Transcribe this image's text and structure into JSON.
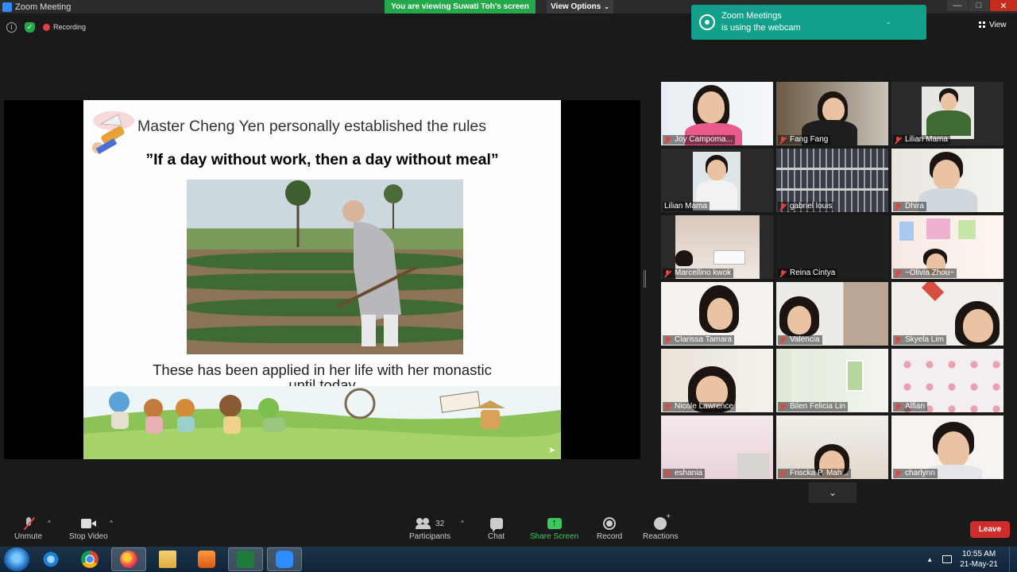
{
  "window": {
    "title": "Zoom Meeting",
    "viewing_banner": "You are viewing Suwati Toh's screen",
    "view_options": "View Options",
    "min": "—",
    "max": "□",
    "close": "✕"
  },
  "meeting_info": {
    "recording_label": "Recording"
  },
  "toast": {
    "line1": "Zoom Meetings",
    "line2": "is using the webcam"
  },
  "view_button": "View",
  "slide": {
    "title": "Master Cheng Yen personally established the rules",
    "quote": "”If a day without work, then a day without meal”",
    "bottom_line1": "These has been applied in her life with her monastic",
    "bottom_line2": "until today"
  },
  "participants_gallery": [
    {
      "name": "Joy Campoma...",
      "muted": true
    },
    {
      "name": "Fang Fang",
      "muted": true
    },
    {
      "name": "Lilian Mama",
      "muted": true
    },
    {
      "name": "Lilian Mama",
      "muted": false,
      "active_speaker": true
    },
    {
      "name": "gabriel louis",
      "muted": true
    },
    {
      "name": "Dhira",
      "muted": true
    },
    {
      "name": "Marcellino kwok",
      "muted": true
    },
    {
      "name": "Reina Cintya",
      "muted": true
    },
    {
      "name": "~Olivia Zhou~",
      "muted": true
    },
    {
      "name": "Clarissa Tamara",
      "muted": true
    },
    {
      "name": "Valencia",
      "muted": true
    },
    {
      "name": "Skyela Lim",
      "muted": true
    },
    {
      "name": "Nicole Lawrence",
      "muted": true
    },
    {
      "name": "Bilen Felicia Lin",
      "muted": true
    },
    {
      "name": "Alfian",
      "muted": true
    },
    {
      "name": "eshania",
      "muted": true
    },
    {
      "name": "Friscka P. Mah...",
      "muted": true
    },
    {
      "name": "charlynn",
      "muted": true
    }
  ],
  "toolbar": {
    "unmute": "Unmute",
    "stop_video": "Stop Video",
    "participants": "Participants",
    "participants_count": "32",
    "chat": "Chat",
    "share_screen": "Share Screen",
    "record": "Record",
    "reactions": "Reactions",
    "leave": "Leave"
  },
  "taskbar": {
    "time": "10:55 AM",
    "date": "21-May-21"
  },
  "colors": {
    "share_green": "#23a84a",
    "toast_teal": "#12a08a",
    "leave_red": "#d12c2c",
    "active_speaker": "#e8dc3c"
  }
}
